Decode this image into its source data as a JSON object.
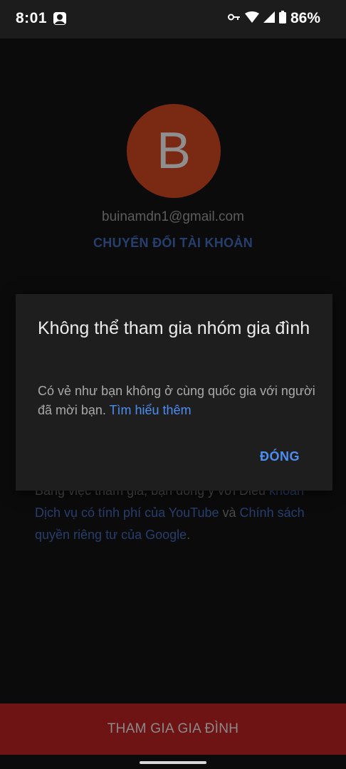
{
  "status_bar": {
    "time": "8:01",
    "battery_percent": "86%",
    "icons": [
      "notification-app-icon",
      "vpn-key-icon",
      "wifi-icon",
      "cellular-signal-icon",
      "battery-icon"
    ]
  },
  "account": {
    "avatar_letter": "B",
    "avatar_color": "#7a2a12",
    "email": "buinamdn1@gmail.com",
    "switch_account_label": "CHUYỂN ĐỔI TÀI KHOẢN"
  },
  "terms": {
    "line_prefix": "Bằng việc tham gia, bạn đồng ý với Điều",
    "link1": "khoản Dịch vụ có tính phí của YouTube",
    "and": " và",
    "link2": "Chính sách quyền riêng tư của Google",
    "period": "."
  },
  "join_button": {
    "label": "THAM GIA GIA ĐÌNH",
    "color": "#6e1414"
  },
  "dialog": {
    "title": "Không thể tham gia nhóm gia đình",
    "message": "Có vẻ như bạn không ở cùng quốc gia với người đã mời bạn. ",
    "learn_more": "Tìm hiểu thêm",
    "close_label": "ĐÓNG",
    "accent_color": "#4e8df0"
  }
}
